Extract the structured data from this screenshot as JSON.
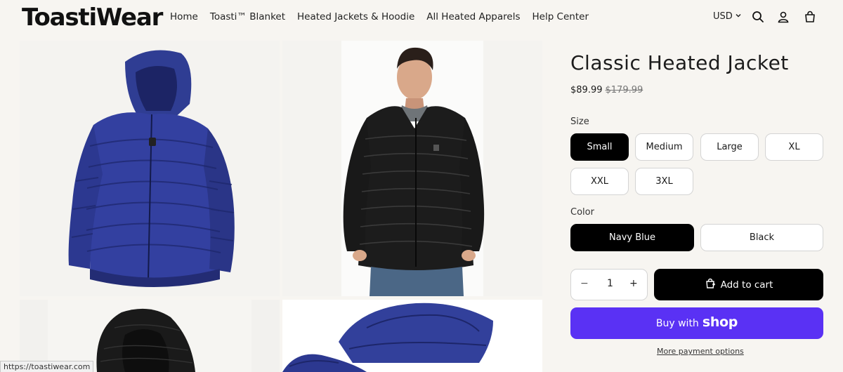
{
  "brand": {
    "logo": "ToastiWear"
  },
  "nav": {
    "items": [
      {
        "label": "Home"
      },
      {
        "label": "Toasti™ Blanket"
      },
      {
        "label": "Heated Jackets & Hoodie"
      },
      {
        "label": "All Heated Apparels"
      },
      {
        "label": "Help Center"
      }
    ]
  },
  "header": {
    "currency": "USD",
    "icons": [
      "search-icon",
      "account-icon",
      "cart-icon"
    ]
  },
  "product": {
    "title": "Classic Heated Jacket",
    "price": "$89.99",
    "compare_price": "$179.99",
    "size_label": "Size",
    "sizes": [
      "Small",
      "Medium",
      "Large",
      "XL",
      "XXL",
      "3XL"
    ],
    "selected_size": "Small",
    "color_label": "Color",
    "colors": [
      "Navy Blue",
      "Black"
    ],
    "selected_color": "Navy Blue",
    "quantity": "1",
    "add_to_cart": "Add to cart",
    "buy_with": "Buy with",
    "shop_pay": "shop",
    "more_options": "More payment options"
  },
  "gallery": {
    "images": [
      "navy-jacket-front",
      "man-black-jacket",
      "black-jacket-hood",
      "navy-jacket-detail"
    ]
  },
  "status_bar": {
    "url": "https://toastiwear.com"
  },
  "colors": {
    "background": "#f7f5f1",
    "selected": "#000000",
    "shop_pay": "#5a31f4",
    "navy": "#2e3a8c"
  }
}
